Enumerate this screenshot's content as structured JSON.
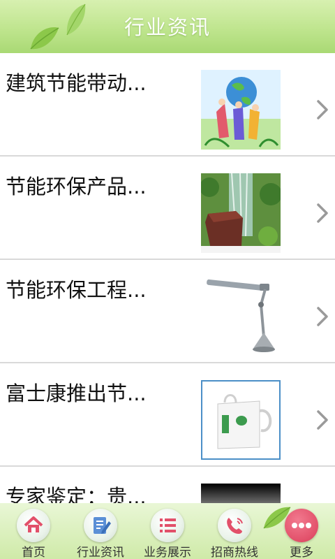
{
  "header": {
    "title": "行业资讯"
  },
  "list": {
    "items": [
      {
        "title": "建筑节能带动...",
        "thumb_icon": "globe-people-illustration"
      },
      {
        "title": "节能环保产品...",
        "thumb_icon": "waterfall-stone-box"
      },
      {
        "title": "节能环保工程...",
        "thumb_icon": "desk-lamp"
      },
      {
        "title": "富士康推出节...",
        "thumb_icon": "eco-tote-bag"
      },
      {
        "title": "专家鉴定：贵...",
        "thumb_icon": "dark-gradient-image"
      }
    ]
  },
  "tabbar": {
    "tabs": [
      {
        "label": "首页",
        "icon": "home-icon"
      },
      {
        "label": "行业资讯",
        "icon": "document-edit-icon"
      },
      {
        "label": "业务展示",
        "icon": "list-icon"
      },
      {
        "label": "招商热线",
        "icon": "phone-icon"
      },
      {
        "label": "更多",
        "icon": "more-icon"
      }
    ]
  },
  "colors": {
    "header_green": "#bfe58e",
    "accent_red": "#e2506a",
    "divider": "#d9d9d9"
  }
}
